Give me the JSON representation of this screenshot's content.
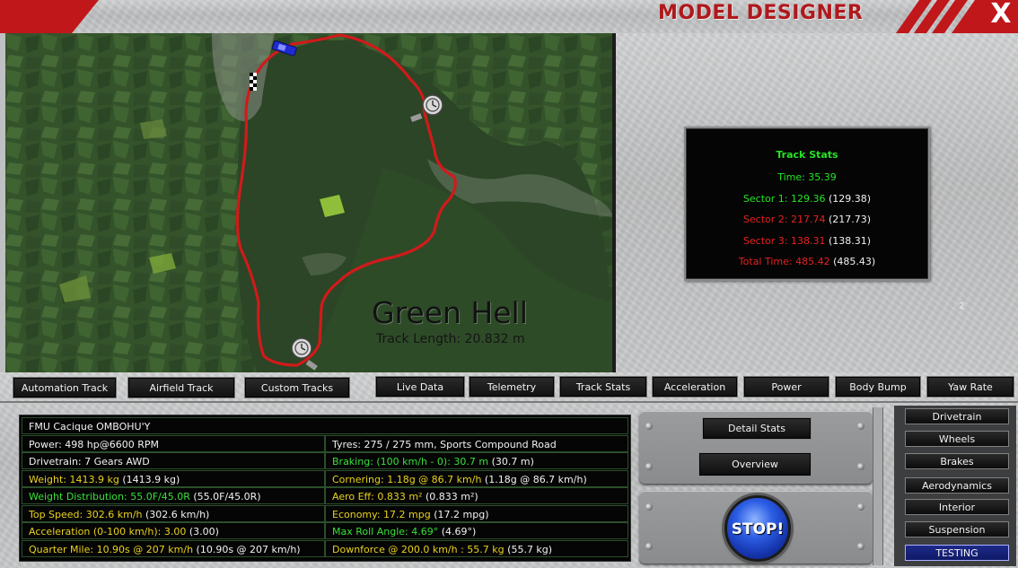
{
  "window": {
    "title": "MODEL DESIGNER",
    "close_label": "X"
  },
  "map": {
    "track_name": "Green Hell",
    "track_length": "Track Length: 20.832 m",
    "colors": {
      "route": "#d11a1a",
      "forest": "#2e4a27"
    }
  },
  "track_stats": {
    "title": "Track Stats",
    "time": "Time: 35.39",
    "sector1_label": "Sector 1: 129.36",
    "sector1_ref": "(129.38)",
    "sector2_label": "Sector 2: 217.74",
    "sector2_ref": "(217.73)",
    "sector3_label": "Sector 3: 138.31",
    "sector3_ref": "(138.31)",
    "total_label": "Total Time: 485.42",
    "total_ref": "(485.43)",
    "page_marker": "2"
  },
  "track_tabs": [
    "Automation Track",
    "Airfield Track",
    "Custom Tracks"
  ],
  "data_tabs": [
    "Live Data",
    "Telemetry",
    "Track Stats",
    "Acceleration",
    "Power",
    "Body Bump",
    "Yaw Rate"
  ],
  "car": {
    "name": "FMU Cacique OMBOHU'Y",
    "power": "Power: 498 hp@6600 RPM",
    "tyres": "Tyres: 275 / 275 mm, Sports Compound Road",
    "drivetrain": "Drivetrain: 7 Gears AWD",
    "braking_label": "Braking: (100 km/h - 0): 30.7 m",
    "braking_ref": " (30.7 m)",
    "weight_label": "Weight: 1413.9 kg",
    "weight_ref": " (1413.9 kg)",
    "cornering_label": "Cornering: 1.18g @ 86.7 km/h",
    "cornering_ref": " (1.18g @ 86.7 km/h)",
    "weight_dist_label": "Weight Distribution: 55.0F/45.0R",
    "weight_dist_ref": " (55.0F/45.0R)",
    "aero_label": "Aero Eff: 0.833 m²",
    "aero_ref": " (0.833 m²)",
    "top_speed_label": "Top Speed: 302.6 km/h",
    "top_speed_ref": " (302.6 km/h)",
    "economy_label": "Economy: 17.2 mpg",
    "economy_ref": " (17.2 mpg)",
    "accel_label": "Acceleration (0-100 km/h): 3.00",
    "accel_ref": " (3.00)",
    "roll_label": "Max Roll Angle: 4.69°",
    "roll_ref": " (4.69°)",
    "quarter_label": "Quarter Mile: 10.90s @ 207 km/h",
    "quarter_ref": " (10.90s @ 207 km/h)",
    "downforce_label": "Downforce @ 200.0 km/h : 55.7 kg",
    "downforce_ref": " (55.7 kg)"
  },
  "controls": {
    "detail_stats": "Detail Stats",
    "overview": "Overview",
    "stop": "STOP!"
  },
  "side_menu": {
    "items": [
      "Drivetrain",
      "Wheels",
      "Brakes",
      "Aerodynamics",
      "Interior",
      "Suspension"
    ],
    "active": "TESTING"
  }
}
